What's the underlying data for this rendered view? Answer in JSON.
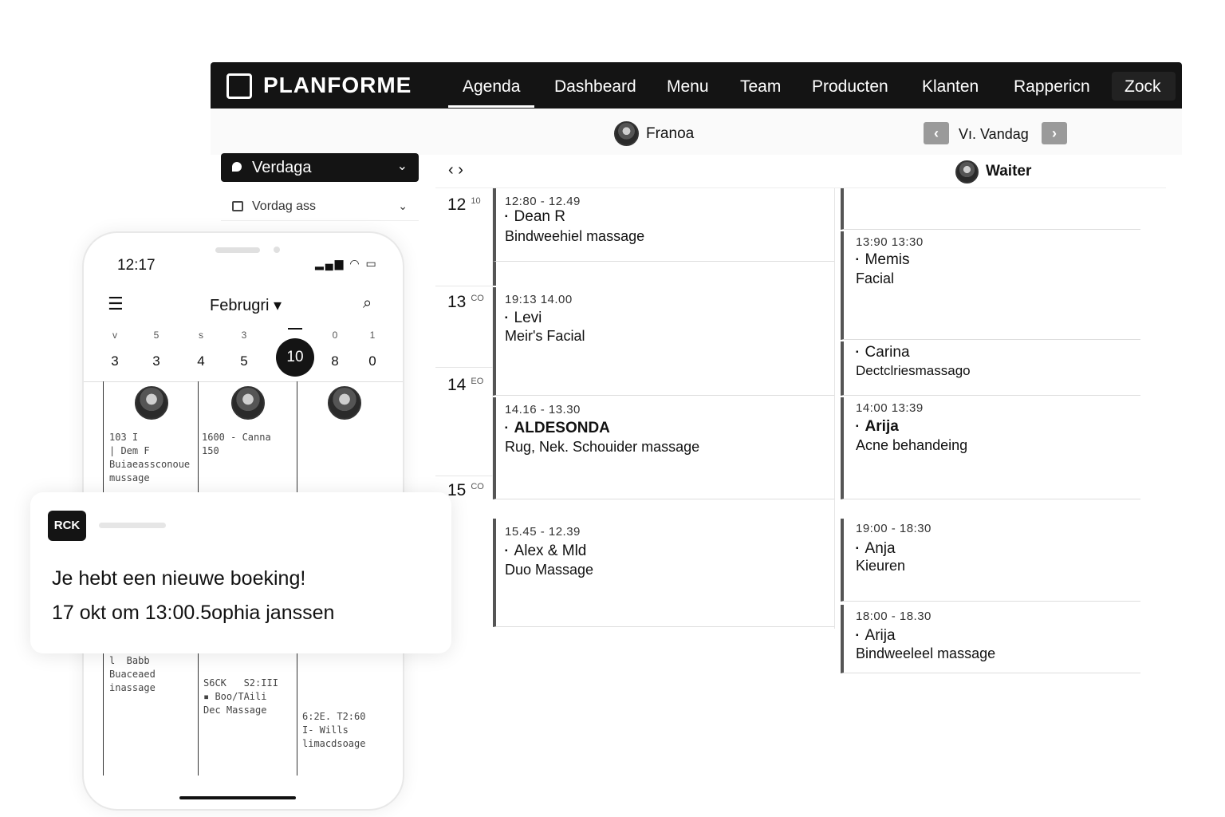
{
  "app": {
    "brand": "PLANFORME",
    "nav": [
      "Agenda",
      "Dashbeard",
      "Menu",
      "Team",
      "Producten",
      "Klanten",
      "Rappericn",
      "Zock"
    ],
    "active_nav": "Agenda"
  },
  "toolbar": {
    "staff1": "Franoa",
    "date_label": "Vı. Vandag",
    "prev": "‹",
    "next": "›"
  },
  "sidebar": {
    "view_select": "Verdaga",
    "secondary_select": "Vordag ass"
  },
  "grid": {
    "nav_arrows": "‹  ›",
    "staff2": "Waiter",
    "hours": [
      {
        "label": "12",
        "sup": "10"
      },
      {
        "label": "13",
        "sup": "CO"
      },
      {
        "label": "14",
        "sup": "EO"
      },
      {
        "label": "15",
        "sup": "CO"
      }
    ],
    "col1_events": [
      {
        "time": "12:80 -  12.49",
        "name": "Dean R",
        "service": "Bindweehiel massage"
      },
      {
        "time": "19:13     14.00",
        "name": "Levi",
        "service": "Meir's Facial"
      },
      {
        "time": "14.16  -  13.30",
        "name": "ALDESONDA",
        "service": "Rug, Nek.  Schouider massage"
      },
      {
        "time": "15.45  -  12.39",
        "name": "Alex & Mld",
        "service": "Duo  Massage"
      }
    ],
    "col2_events": [
      {
        "time": "13:90      13:30",
        "name": "Memis",
        "service": "Facial"
      },
      {
        "time": "",
        "name": "Carina",
        "service": "Dectclriesmassago"
      },
      {
        "time": "14:00      13:39",
        "name": "Arija",
        "service": "Acne behandeing"
      },
      {
        "time": "19:00  - 18:30",
        "name": "Anja",
        "service": "Kieuren"
      },
      {
        "time": "18:00 - 18.30",
        "name": "Arija",
        "service": "Bindweeleel massage"
      }
    ]
  },
  "phone": {
    "time": "12:17",
    "status": "▂▄▆ ◠ ▭",
    "month": "Februgri ▾",
    "weekdays": [
      "v",
      "5",
      "s",
      "3",
      "",
      "0",
      "1"
    ],
    "days": [
      "3",
      "3",
      "4",
      "5",
      "10",
      "8",
      "0"
    ],
    "active_day": "10",
    "events": [
      "103 I\n| Dem F\nBuiaeassconoue\nmussage",
      "1600 - Canna\n150",
      "l  Babb\nBuaceaed\ninassage",
      "S6CK   S2:III\n▪ Boo/TAili\nDec Massage",
      "6:2E. T2:60\nI- Wills\nlimacdsoage"
    ]
  },
  "notification": {
    "badge": "RCK",
    "title": "Je hebt een nieuwe boeking!",
    "subtitle": "17 okt om 13:00.5ophia janssen"
  },
  "colors": {
    "dark": "#141414",
    "accent_gray": "#9a9a9a"
  }
}
